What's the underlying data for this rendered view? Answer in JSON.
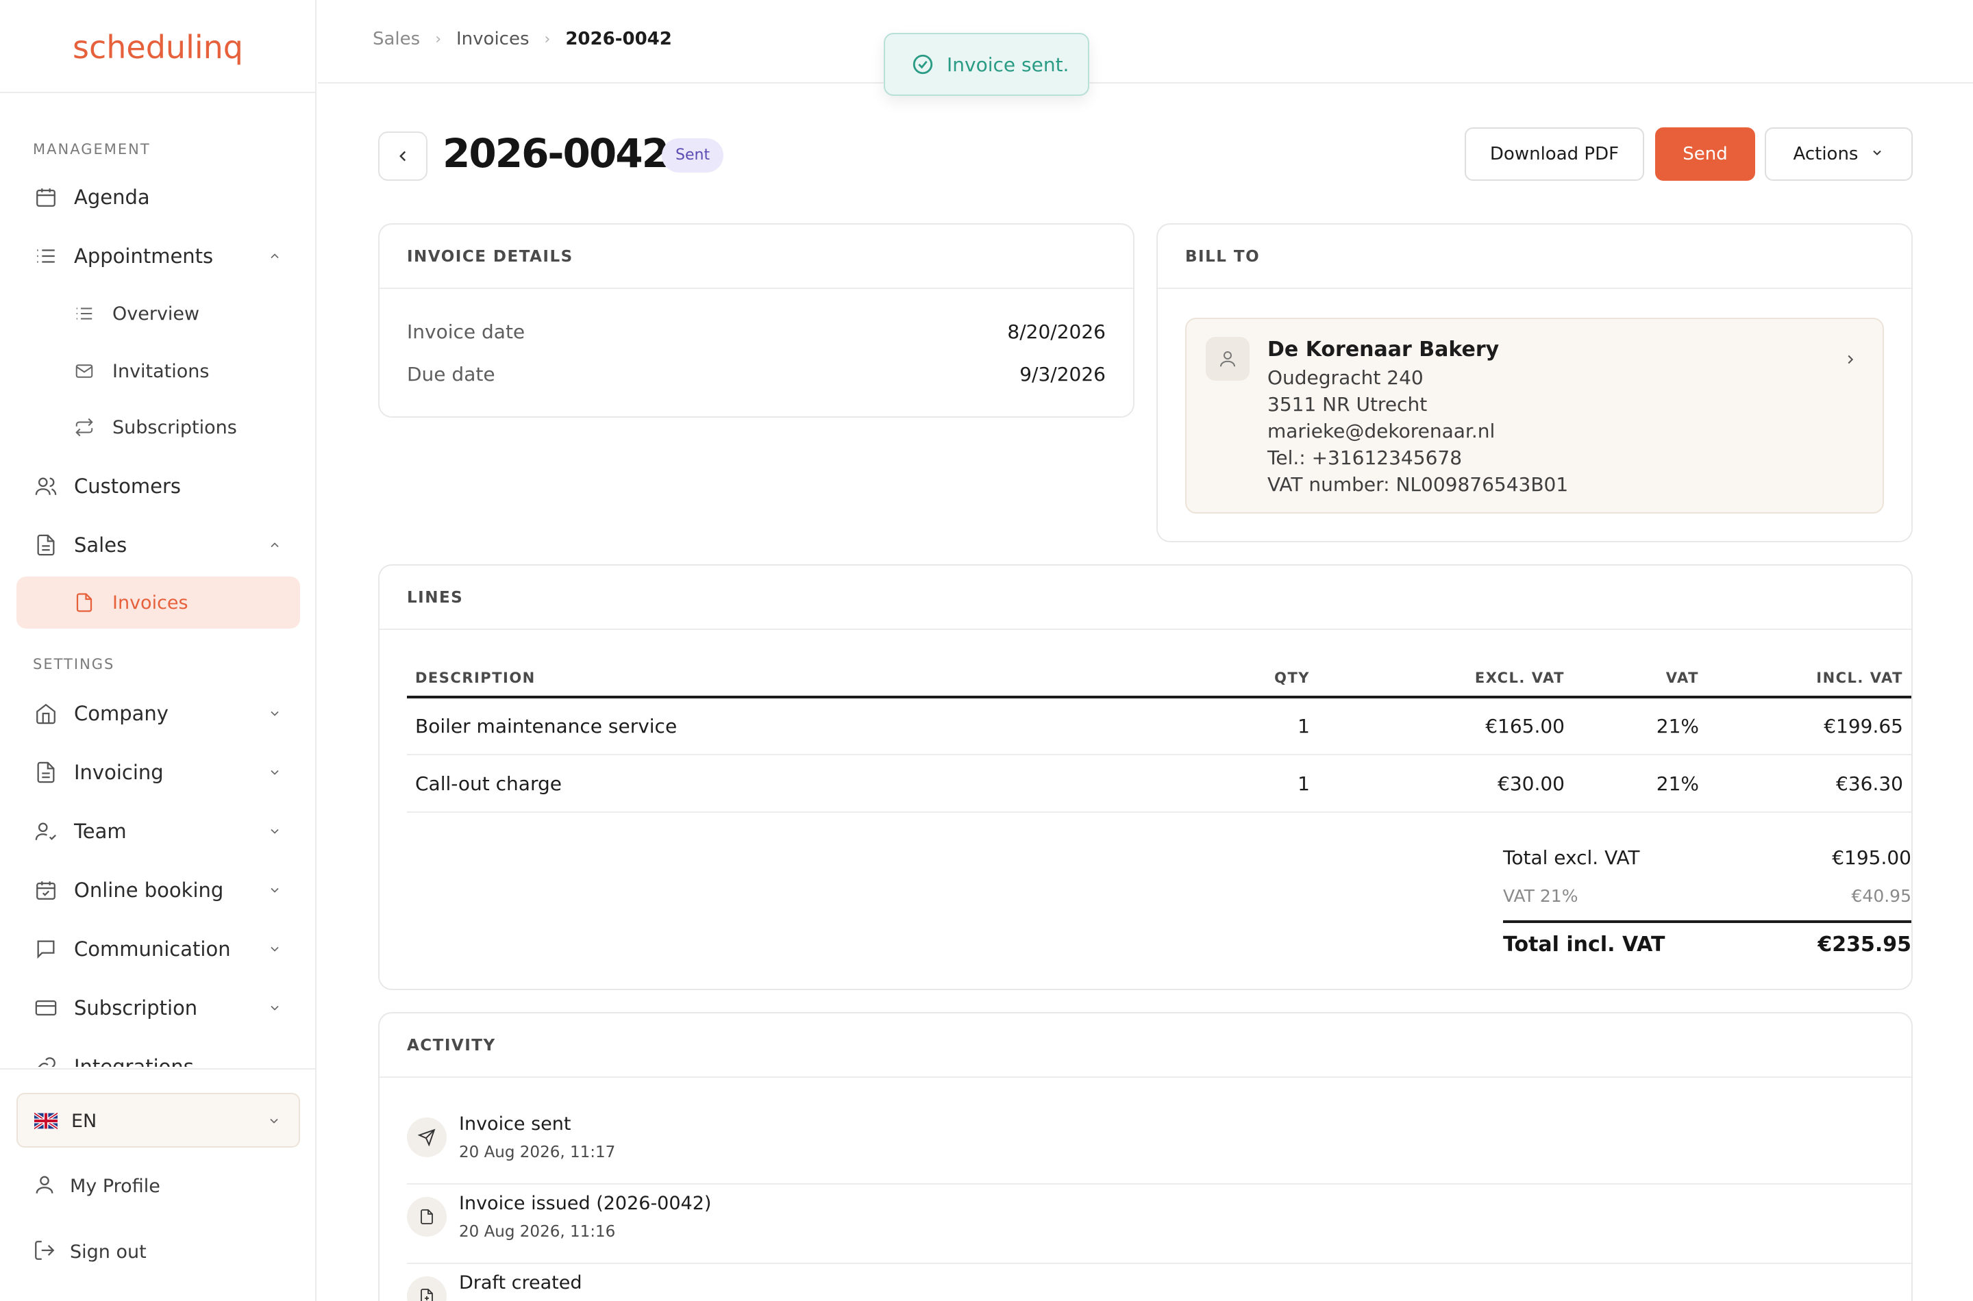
{
  "app": {
    "logo": "schedulinq"
  },
  "sidebar": {
    "management_heading": "MANAGEMENT",
    "settings_heading": "SETTINGS",
    "items": {
      "agenda": "Agenda",
      "appointments": "Appointments",
      "overview": "Overview",
      "invitations": "Invitations",
      "subscriptions": "Subscriptions",
      "customers": "Customers",
      "sales": "Sales",
      "invoices": "Invoices",
      "company": "Company",
      "invoicing": "Invoicing",
      "team": "Team",
      "online_booking": "Online booking",
      "communication": "Communication",
      "subscription": "Subscription",
      "integrations": "Integrations"
    },
    "language": "EN",
    "my_profile": "My Profile",
    "sign_out": "Sign out"
  },
  "breadcrumb": {
    "sales": "Sales",
    "invoices": "Invoices",
    "current": "2026-0042"
  },
  "toast": {
    "message": "Invoice sent."
  },
  "header": {
    "title": "2026-0042",
    "status": "Sent",
    "download_pdf": "Download PDF",
    "send": "Send",
    "actions": "Actions"
  },
  "invoice_details": {
    "heading": "INVOICE DETAILS",
    "invoice_date_label": "Invoice date",
    "invoice_date": "8/20/2026",
    "due_date_label": "Due date",
    "due_date": "9/3/2026"
  },
  "bill_to": {
    "heading": "BILL TO",
    "name": "De Korenaar Bakery",
    "address": "Oudegracht 240",
    "city": "3511 NR Utrecht",
    "email": "marieke@dekorenaar.nl",
    "phone": "Tel.: +31612345678",
    "vat": "VAT number: NL009876543B01"
  },
  "lines": {
    "heading": "LINES",
    "columns": {
      "description": "DESCRIPTION",
      "qty": "QTY",
      "excl": "EXCL. VAT",
      "vat": "VAT",
      "incl": "INCL. VAT"
    },
    "rows": [
      {
        "description": "Boiler maintenance service",
        "qty": "1",
        "excl": "€165.00",
        "vat": "21%",
        "incl": "€199.65"
      },
      {
        "description": "Call-out charge",
        "qty": "1",
        "excl": "€30.00",
        "vat": "21%",
        "incl": "€36.30"
      }
    ],
    "totals": {
      "excl_label": "Total excl. VAT",
      "excl": "€195.00",
      "vat_label": "VAT 21%",
      "vat": "€40.95",
      "incl_label": "Total incl. VAT",
      "incl": "€235.95"
    }
  },
  "activity": {
    "heading": "ACTIVITY",
    "items": [
      {
        "title": "Invoice sent",
        "time": "20 Aug 2026, 11:17",
        "icon": "send-icon"
      },
      {
        "title": "Invoice issued (2026-0042)",
        "time": "20 Aug 2026, 11:16",
        "icon": "document-icon"
      },
      {
        "title": "Draft created",
        "time": "",
        "icon": "document-plus-icon"
      }
    ]
  },
  "colors": {
    "accent": "#e8603a",
    "badge_bg": "#ece8fb",
    "badge_text": "#5b4bb3",
    "toast_bg": "#e9f6f3",
    "toast_text": "#2a9b85"
  }
}
